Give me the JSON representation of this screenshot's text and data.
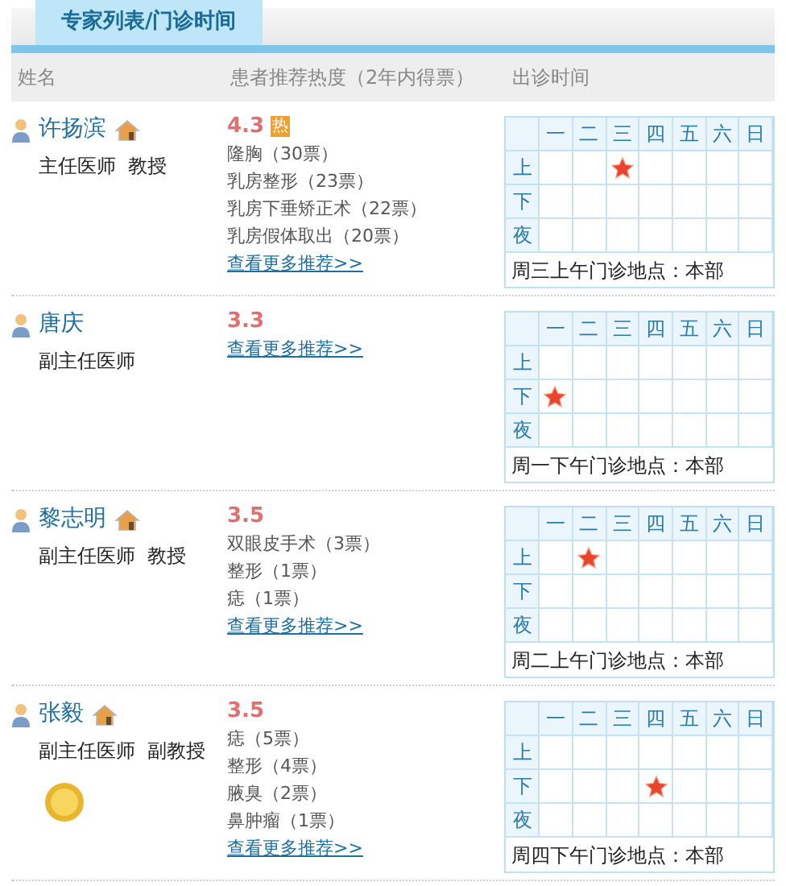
{
  "tab": {
    "label": "专家列表/门诊时间",
    "selected": true
  },
  "columns": [
    "姓名",
    "患者推荐热度（2年内得票）",
    "出诊时间"
  ],
  "doctors": [
    {
      "name": "许扬滨",
      "home": true,
      "title": "主任医师  教授",
      "medal": false,
      "score": "4.3",
      "hot": "热",
      "votes": [
        "隆胸（30票）",
        "乳房整形（23票）",
        "乳房下垂矫正术（22票）",
        "乳房假体取出（20票）"
      ],
      "more": "查看更多推荐>>",
      "schedule": {
        "days": [
          "一",
          "二",
          "三",
          "四",
          "五",
          "六",
          "日"
        ],
        "rows": [
          {
            "period": "上",
            "slots": [
              false,
              false,
              true,
              false,
              false,
              false,
              false
            ]
          },
          {
            "period": "下",
            "slots": [
              false,
              false,
              false,
              false,
              false,
              false,
              false
            ]
          },
          {
            "period": "夜",
            "slots": [
              false,
              false,
              false,
              false,
              false,
              false,
              false
            ]
          }
        ],
        "note": "周三上午门诊地点：本部"
      }
    },
    {
      "name": "唐庆",
      "home": false,
      "title": "副主任医师",
      "medal": false,
      "score": "3.3",
      "more": "查看更多推荐>>",
      "schedule": {
        "days": [
          "一",
          "二",
          "三",
          "四",
          "五",
          "六",
          "日"
        ],
        "rows": [
          {
            "period": "上",
            "slots": [
              false,
              false,
              false,
              false,
              false,
              false,
              false
            ]
          },
          {
            "period": "下",
            "slots": [
              true,
              false,
              false,
              false,
              false,
              false,
              false
            ]
          },
          {
            "period": "夜",
            "slots": [
              false,
              false,
              false,
              false,
              false,
              false,
              false
            ]
          }
        ],
        "note": "周一下午门诊地点：本部"
      }
    },
    {
      "name": "黎志明",
      "home": true,
      "title": "副主任医师  教授",
      "medal": false,
      "score": "3.5",
      "votes": [
        "双眼皮手术（3票）",
        "整形（1票）",
        "痣（1票）"
      ],
      "more": "查看更多推荐>>",
      "schedule": {
        "days": [
          "一",
          "二",
          "三",
          "四",
          "五",
          "六",
          "日"
        ],
        "rows": [
          {
            "period": "上",
            "slots": [
              false,
              true,
              false,
              false,
              false,
              false,
              false
            ]
          },
          {
            "period": "下",
            "slots": [
              false,
              false,
              false,
              false,
              false,
              false,
              false
            ]
          },
          {
            "period": "夜",
            "slots": [
              false,
              false,
              false,
              false,
              false,
              false,
              false
            ]
          }
        ],
        "note": "周二上午门诊地点：本部"
      }
    },
    {
      "name": "张毅",
      "home": true,
      "title": "副主任医师  副教授",
      "medal": true,
      "score": "3.5",
      "votes": [
        "痣（5票）",
        "整形（4票）",
        "腋臭（2票）",
        "鼻肿瘤（1票）"
      ],
      "more": "查看更多推荐>>",
      "schedule": {
        "days": [
          "一",
          "二",
          "三",
          "四",
          "五",
          "六",
          "日"
        ],
        "rows": [
          {
            "period": "上",
            "slots": [
              false,
              false,
              false,
              false,
              false,
              false,
              false
            ]
          },
          {
            "period": "下",
            "slots": [
              false,
              false,
              false,
              true,
              false,
              false,
              false
            ]
          },
          {
            "period": "夜",
            "slots": [
              false,
              false,
              false,
              false,
              false,
              false,
              false
            ]
          }
        ],
        "note": "周四下午门诊地点：本部"
      }
    }
  ]
}
